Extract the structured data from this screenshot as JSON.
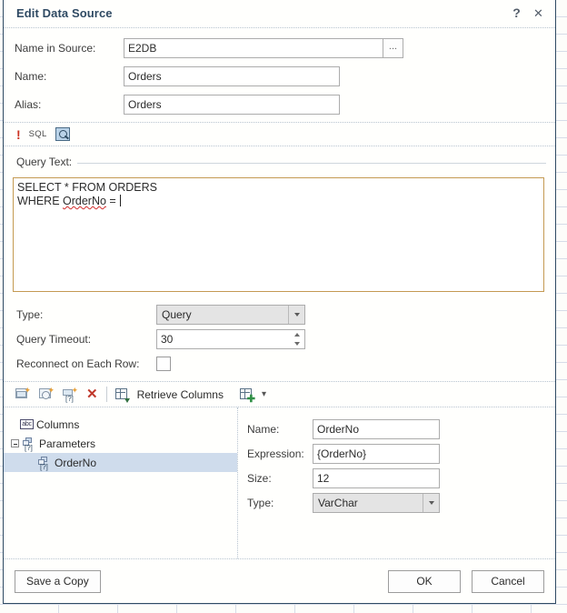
{
  "window": {
    "title": "Edit Data Source",
    "help_label": "?",
    "close_label": "✕"
  },
  "top_fields": {
    "name_in_source": {
      "label": "Name in Source:",
      "value": "E2DB",
      "browse_label": "..."
    },
    "name": {
      "label": "Name:",
      "value": "Orders"
    },
    "alias": {
      "label": "Alias:",
      "value": "Orders"
    }
  },
  "sql_bar": {
    "warning_glyph": "!",
    "sql_label": "SQL",
    "query_builder_icon": "query-builder-icon"
  },
  "query": {
    "header_label": "Query Text:",
    "line1": "SELECT * FROM ORDERS",
    "line2_prefix": "WHERE ",
    "line2_token": "OrderNo",
    "line2_suffix": " = "
  },
  "options": {
    "type": {
      "label": "Type:",
      "value": "Query"
    },
    "query_timeout": {
      "label": "Query Timeout:",
      "value": "30"
    },
    "reconnect": {
      "label": "Reconnect on Each Row:",
      "checked": false
    }
  },
  "columns_toolbar": {
    "add_column_icon": "add-column-icon",
    "add_expression_column_icon": "add-expression-column-icon",
    "add_parameter_icon": "add-parameter-icon",
    "delete_icon": "✕",
    "retrieve_columns_label": "Retrieve Columns",
    "retrieve_columns_icon": "retrieve-columns-icon",
    "add_table_icon": "add-table-icon",
    "dropdown_glyph": "▾"
  },
  "tree": {
    "nodes": [
      {
        "label": "Columns",
        "kind": "columns",
        "indent": 18,
        "twisty": false,
        "selected": false
      },
      {
        "label": "Parameters",
        "kind": "parameter",
        "indent": 8,
        "twisty": true,
        "selected": false
      },
      {
        "label": "OrderNo",
        "kind": "parameter",
        "indent": 38,
        "twisty": false,
        "selected": true
      }
    ]
  },
  "properties": {
    "name": {
      "label": "Name:",
      "value": "OrderNo"
    },
    "expression": {
      "label": "Expression:",
      "value": "{OrderNo}"
    },
    "size": {
      "label": "Size:",
      "value": "12"
    },
    "type": {
      "label": "Type:",
      "value": "VarChar"
    }
  },
  "footer": {
    "save_copy_label": "Save a Copy",
    "ok_label": "OK",
    "cancel_label": "Cancel"
  },
  "colors": {
    "title": "#2f4a63",
    "query_box_border": "#c49a52",
    "selection": "#cfdcec",
    "warning": "#cc3322",
    "delete": "#c0392b"
  }
}
